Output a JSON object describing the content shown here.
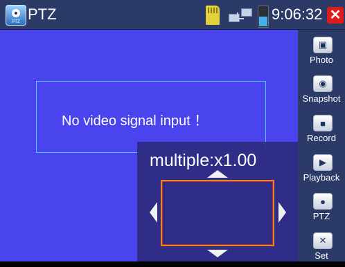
{
  "titlebar": {
    "title": "PTZ",
    "app_icon_label": "PTZ",
    "clock": "9:06:32",
    "close_glyph": "✕",
    "status_icons": [
      "sd-card-icon",
      "network-icon",
      "battery-icon"
    ],
    "close_color": "#e01a1a"
  },
  "video": {
    "message": "No video signal input ！",
    "background_color": "#4a44ef"
  },
  "ptz": {
    "zoom_text": "multiple:x1.00",
    "arrows": [
      "up",
      "down",
      "left",
      "right"
    ],
    "zoom_box_color": "#f0841a"
  },
  "sidebar": {
    "items": [
      {
        "label": "Photo",
        "icon": "photo-icon",
        "glyph": "▣"
      },
      {
        "label": "Snapshot",
        "icon": "camera-icon",
        "glyph": "◉"
      },
      {
        "label": "Record",
        "icon": "video-camera-icon",
        "glyph": "■"
      },
      {
        "label": "Playback",
        "icon": "playback-icon",
        "glyph": "▶"
      },
      {
        "label": "PTZ",
        "icon": "ptz-camera-icon",
        "glyph": "●"
      },
      {
        "label": "Set",
        "icon": "settings-tools-icon",
        "glyph": "✕"
      }
    ]
  }
}
